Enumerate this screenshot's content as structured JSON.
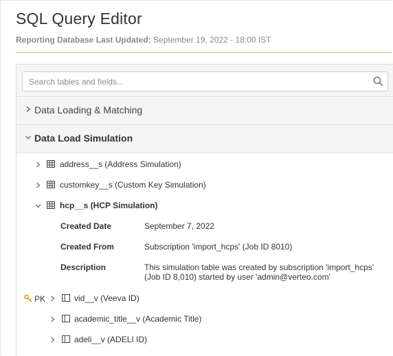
{
  "header": {
    "title": "SQL Query Editor",
    "updated_label": "Reporting Database Last Updated:",
    "updated_value": "September 19, 2022 - 18:00 IST"
  },
  "search": {
    "placeholder": "Search tables and fields...",
    "value": ""
  },
  "sections": [
    {
      "label": "Data Loading & Matching",
      "expanded": false
    },
    {
      "label": "Data Load Simulation",
      "expanded": true
    }
  ],
  "tables": [
    {
      "label": "address__s (Address Simulation)",
      "expanded": false
    },
    {
      "label": "customkey__s (Custom Key Simulation)",
      "expanded": false
    },
    {
      "label": "hcp__s (HCP Simulation)",
      "expanded": true
    }
  ],
  "details": {
    "created_date_label": "Created Date",
    "created_date_value": "September 7, 2022",
    "created_from_label": "Created From",
    "created_from_value": "Subscription 'import_hcps' (Job ID 8010)",
    "description_label": "Description",
    "description_line1": "This simulation table was created by subscription 'import_hcps'",
    "description_line2": "(Job ID 8,010) started by user 'admin@verteo.com'"
  },
  "fields": [
    {
      "label": "vid__v (Veeva ID)",
      "pk": true
    },
    {
      "label": "academic_title__v (Academic Title)",
      "pk": false
    },
    {
      "label": "adeli__v (ADELI ID)",
      "pk": false
    }
  ],
  "pk_label": "PK",
  "colors": {
    "accent_rule": "#f2b26b",
    "pk_key": "#e0a020"
  },
  "icons": [
    "search-icon",
    "chevron-right-icon",
    "chevron-down-icon",
    "table-grid-icon",
    "field-column-icon",
    "key-icon"
  ]
}
